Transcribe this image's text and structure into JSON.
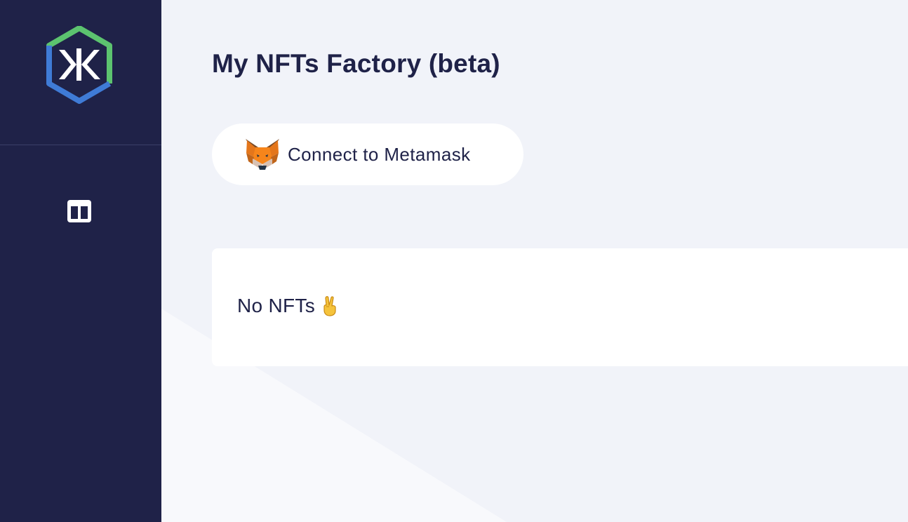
{
  "sidebar": {
    "logo": "kuzzle-hexagon-logo",
    "items": [
      {
        "icon": "columns-icon",
        "active": true
      }
    ]
  },
  "main": {
    "title": "My NFTs Factory (beta)",
    "connect_button": {
      "icon": "metamask-fox-icon",
      "label": "Connect to Metamask"
    },
    "nft_panel": {
      "empty_text": "No NFTs",
      "empty_icon": "victory-hand-icon"
    }
  },
  "colors": {
    "sidebar_bg": "#1f2248",
    "page_bg": "#f1f3f9",
    "text_primary": "#1f2248",
    "logo_green": "#5cc36f",
    "logo_blue": "#3f7bd6",
    "card_bg": "#ffffff"
  }
}
